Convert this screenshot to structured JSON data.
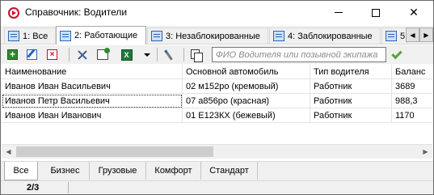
{
  "window": {
    "title": "Справочник: Водители"
  },
  "tabs": [
    {
      "label": "1: Все"
    },
    {
      "label": "2: Работающие"
    },
    {
      "label": "3: Незаблокированные"
    },
    {
      "label": "4: Заблокированные"
    },
    {
      "label": "5"
    }
  ],
  "toolbar": {
    "search_placeholder": "ФИО Водителя или позывной экипажа"
  },
  "table": {
    "columns": [
      "Наименование",
      "Основной автомобиль",
      "Тип водителя",
      "Баланс"
    ],
    "rows": [
      [
        "Иванов Иван Васильевич",
        "02 м152ро (кремовый)",
        "Работник",
        "3689"
      ],
      [
        "Иванов Петр Васильевич",
        "07 а856ро (красная)",
        "Работник",
        "988,3"
      ],
      [
        "Иванов Иван Иванович",
        "01 Е123КХ (бежевый)",
        "Работник",
        "1170"
      ]
    ]
  },
  "bottom_tabs": [
    {
      "label": "Все"
    },
    {
      "label": "Бизнес"
    },
    {
      "label": "Грузовые"
    },
    {
      "label": "Комфорт"
    },
    {
      "label": "Стандарт"
    }
  ],
  "status": {
    "record": "2/3"
  },
  "colors": {
    "accent": "#c8102e",
    "ok": "#59a23a",
    "excel": "#1f7a3a"
  }
}
